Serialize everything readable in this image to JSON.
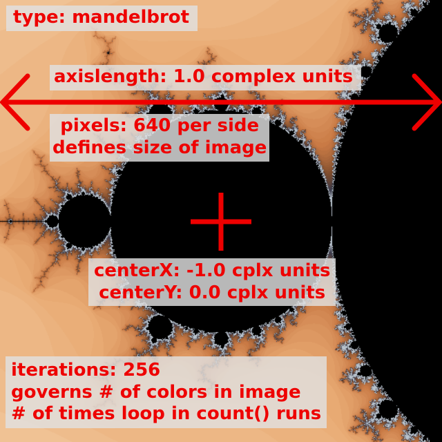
{
  "labels": {
    "type": "type: mandelbrot",
    "axislength": "axislength: 1.0 complex units",
    "pixels_line1": "pixels: 640 per side",
    "pixels_line2": "defines size of image",
    "centerx": "centerX: -1.0 cplx units",
    "centery": "centerY: 0.0 cplx units",
    "iterations_line1": "iterations: 256",
    "iterations_line2": "governs # of colors in image",
    "iterations_line3": "# of times loop in count() runs"
  },
  "fractal": {
    "type": "mandelbrot",
    "center_x": -1.0,
    "center_y": 0.0,
    "axis_length": 1.0,
    "iterations": 256
  },
  "colors": {
    "annotation": "#ee0000",
    "label_background": "#e1e1e1",
    "inside_set": "#000000",
    "palette": [
      "#f6dcbf",
      "#f2c79a",
      "#e8a972",
      "#c97a45",
      "#7a4a2c",
      "#3a3a4a",
      "#b8c2cc"
    ]
  }
}
